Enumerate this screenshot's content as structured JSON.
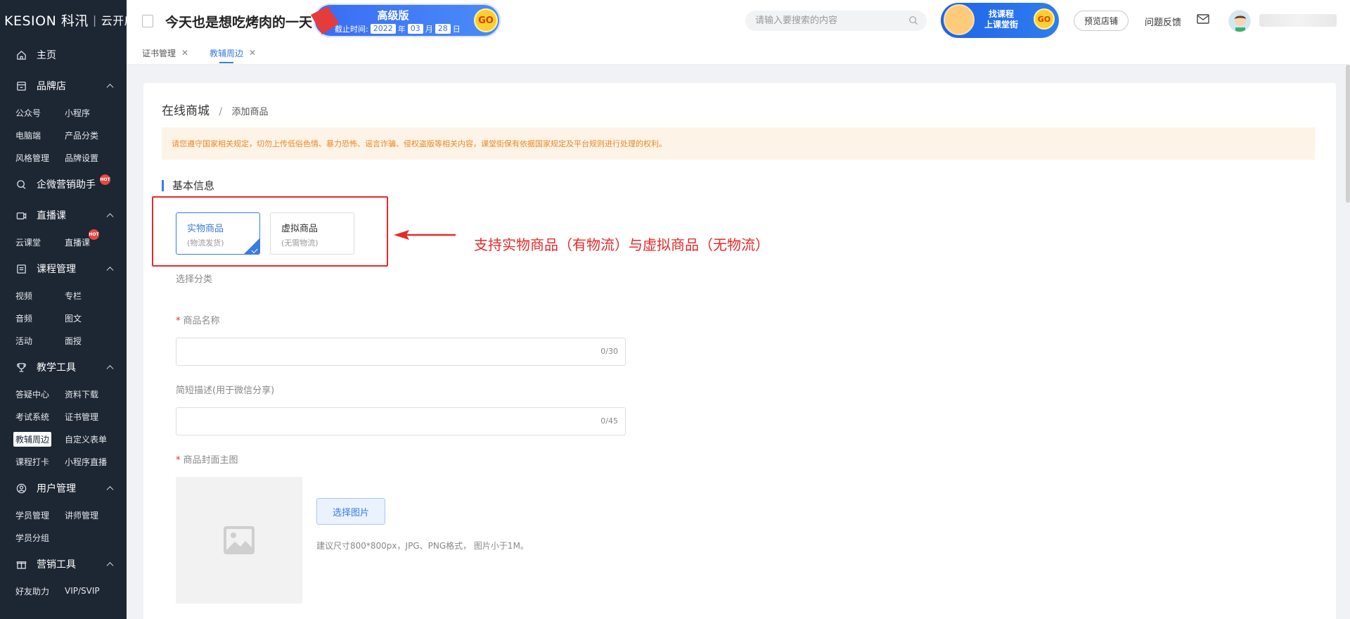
{
  "logo": {
    "brand": "KESION 科汛",
    "sub": "云开店"
  },
  "sidebar": {
    "home": "主页",
    "sections": [
      {
        "title": "品牌店",
        "icon": "store-icon",
        "items": [
          "公众号",
          "小程序",
          "电脑端",
          "产品分类",
          "风格管理",
          "品牌设置"
        ]
      },
      {
        "title": "企微营销助手",
        "icon": "chat-icon",
        "hot": true,
        "items": []
      },
      {
        "title": "直播课",
        "icon": "live-icon",
        "items": [
          "云课堂",
          "直播课"
        ]
      },
      {
        "title": "课程管理",
        "icon": "course-icon",
        "items": [
          "视频",
          "专栏",
          "音频",
          "图文",
          "活动",
          "面授"
        ]
      },
      {
        "title": "教学工具",
        "icon": "trophy-icon",
        "items": [
          "答疑中心",
          "资料下载",
          "考试系统",
          "证书管理",
          "教辅周边",
          "自定义表单",
          "课程打卡",
          "小程序直播"
        ]
      },
      {
        "title": "用户管理",
        "icon": "user-icon",
        "items": [
          "学员管理",
          "讲师管理",
          "学员分组"
        ]
      },
      {
        "title": "营销工具",
        "icon": "gift-icon",
        "items": [
          "好友助力",
          "VIP/SVIP"
        ]
      }
    ],
    "hot_badge": "HOT",
    "active_item": "教辅周边"
  },
  "topbar": {
    "store_title": "今天也是想吃烤肉的一天",
    "pro_banner": {
      "label": "高级版",
      "expire_prefix": "截止时间:",
      "year": "2022",
      "year_unit": "年",
      "month": "03",
      "month_unit": "月",
      "day": "28",
      "day_unit": "日",
      "go": "GO"
    },
    "search_placeholder": "请输入要搜索的内容",
    "find_course": {
      "line1": "找课程",
      "line2": "上课堂街",
      "go": "GO"
    },
    "preview": "预览店铺",
    "feedback": "问题反馈"
  },
  "tabs": [
    {
      "label": "证书管理",
      "active": false
    },
    {
      "label": "教辅周边",
      "active": true
    }
  ],
  "content": {
    "breadcrumb": {
      "root": "在线商城",
      "sep": "/",
      "current": "添加商品"
    },
    "notice": "请您遵守国家相关规定，切勿上传低俗色情、暴力恐怖、谣言诈骗、侵权盗版等相关内容，课堂街保有依据国家规定及平台规则进行处理的权利。",
    "section_title": "基本信息",
    "product_types": [
      {
        "title": "实物商品",
        "sub": "(物流发货)",
        "selected": true
      },
      {
        "title": "虚拟商品",
        "sub": "(无需物流)",
        "selected": false
      }
    ],
    "annotation": "支持实物商品（有物流）与虚拟商品（无物流）",
    "category_label": "选择分类",
    "name_field": {
      "label": "商品名称",
      "required": true,
      "count": "0/30",
      "value": ""
    },
    "desc_field": {
      "label": "简短描述(用于微信分享)",
      "required": false,
      "count": "0/45",
      "value": ""
    },
    "cover": {
      "label": "商品封面主图",
      "required": true,
      "button": "选择图片",
      "hint": "建议尺寸800*800px，JPG、PNG格式， 图片小于1M。"
    }
  },
  "colors": {
    "sidebar_bg": "#1d2633",
    "accent": "#3a7be0",
    "annotation_red": "#e52a2a",
    "notice_bg": "#fdf3e7",
    "notice_text": "#e88a2b"
  }
}
